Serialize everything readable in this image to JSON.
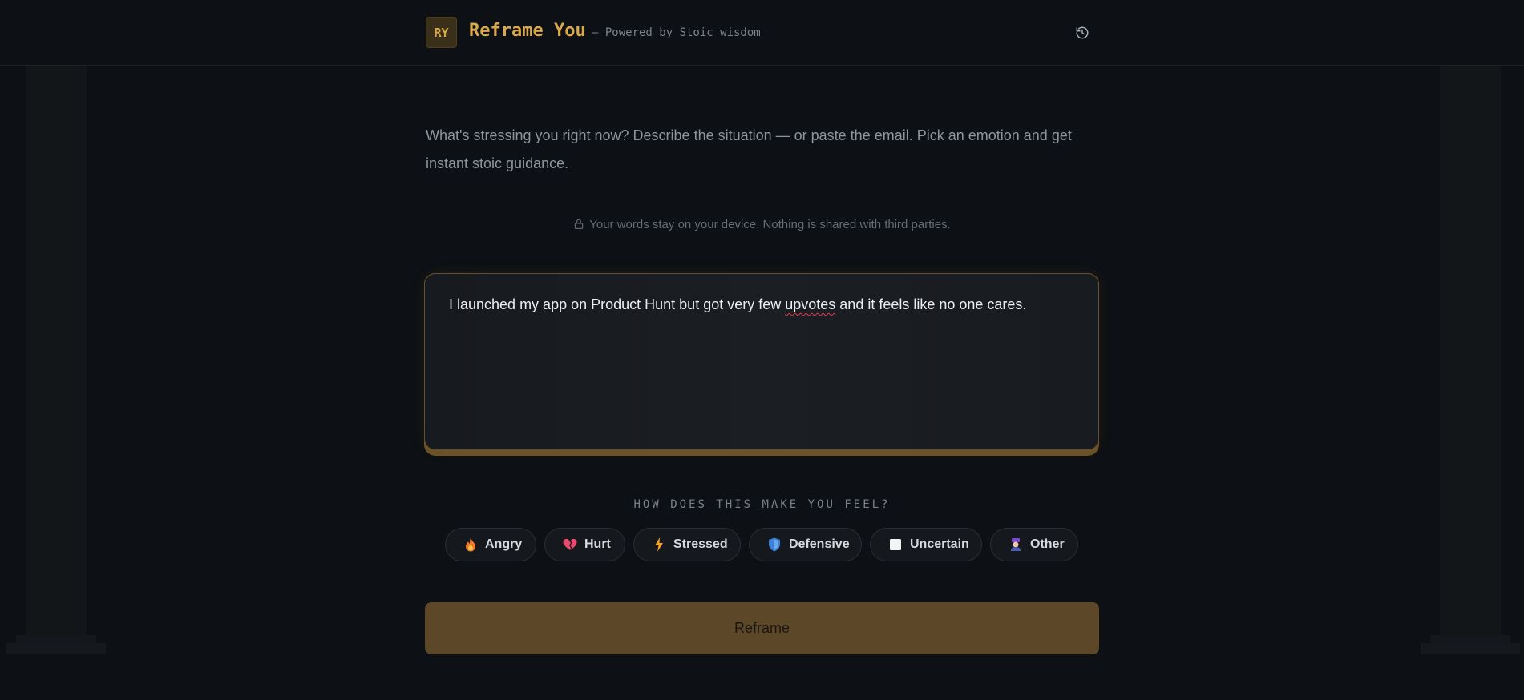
{
  "header": {
    "logo_initials": "RY",
    "app_name": "Reframe You",
    "tagline": "— Powered by Stoic wisdom",
    "history_icon": "history-icon"
  },
  "intro": {
    "text": "What's stressing you right now? Describe the situation — or paste the email. Pick an emotion and get instant stoic guidance."
  },
  "privacy": {
    "icon": "lock-icon",
    "text": "Your words stay on your device. Nothing is shared with third parties."
  },
  "situation_input": {
    "value_before": "I launched my app on Product Hunt but got very few ",
    "value_misspelled": "upvotes",
    "value_after": " and it feels like no one cares."
  },
  "feelings": {
    "label": "HOW DOES THIS MAKE YOU FEEL?",
    "options": [
      {
        "label": "Angry",
        "icon": "fire-icon"
      },
      {
        "label": "Hurt",
        "icon": "broken-heart-icon"
      },
      {
        "label": "Stressed",
        "icon": "lightning-icon"
      },
      {
        "label": "Defensive",
        "icon": "shield-icon"
      },
      {
        "label": "Uncertain",
        "icon": "blank-square-icon"
      },
      {
        "label": "Other",
        "icon": "other-icon"
      }
    ]
  },
  "actions": {
    "reframe_label": "Reframe"
  },
  "colors": {
    "accent": "#d9a84a",
    "button": "#5c4729",
    "background": "#0d1014"
  }
}
